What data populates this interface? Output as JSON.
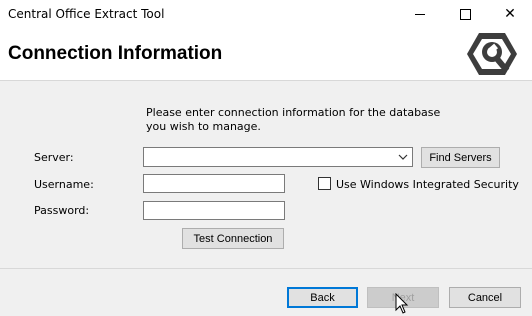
{
  "window": {
    "title": "Central Office Extract Tool",
    "minimize_glyph": "minimize",
    "maximize_glyph": "maximize",
    "close_glyph": "✕"
  },
  "header": {
    "title": "Connection Information",
    "logo_icon": "wrench-hex-logo"
  },
  "form": {
    "instructions_line1": "Please enter connection information for the database",
    "instructions_line2": "you wish to manage.",
    "server_label": "Server:",
    "server_value": "",
    "username_label": "Username:",
    "username_value": "",
    "password_label": "Password:",
    "password_value": "",
    "find_servers_label": "Find Servers",
    "integrated_security_label": "Use Windows Integrated Security",
    "integrated_security_checked": false,
    "test_connection_label": "Test Connection"
  },
  "footer": {
    "back_label": "Back",
    "next_label": "Next",
    "cancel_label": "Cancel"
  },
  "colors": {
    "accent": "#0078d7",
    "logo": "#3d3d3d"
  }
}
